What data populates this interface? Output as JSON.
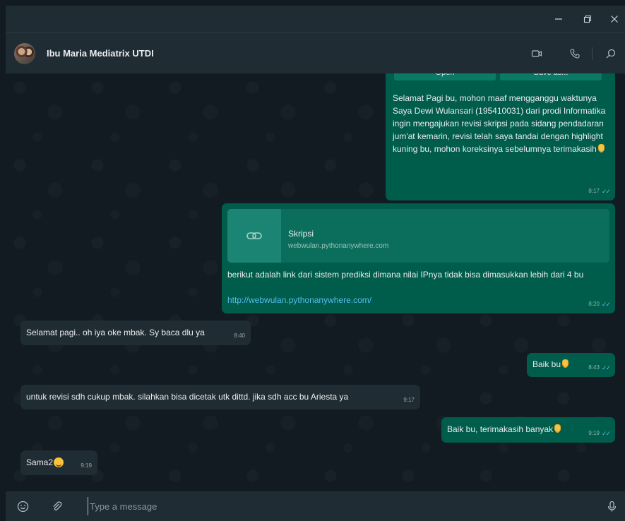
{
  "window": {
    "minimize_icon": "minimize-icon",
    "restore_icon": "restore-icon",
    "close_icon": "close-icon"
  },
  "header": {
    "contact_name": "Ibu Maria Mediatrix UTDI",
    "icons": [
      "video-call-icon",
      "voice-call-icon",
      "search-icon"
    ]
  },
  "messages": [
    {
      "direction": "out",
      "doc_buttons": [
        "Open",
        "Save as..."
      ],
      "text": "Selamat Pagi bu, mohon maaf mengganggu waktunya\nSaya Dewi Wulansari (195410031) dari prodi Informatika ingin mengajukan revisi skripsi pada sidang pendadaran jum'at kemarin, revisi telah saya tandai dengan highlight kuning bu, mohon koreksinya sebelumnya terimakasih",
      "emoji": "pray",
      "time": "8:17",
      "read": true
    },
    {
      "direction": "out",
      "link_title": "Skripsi",
      "link_domain": "webwulan.pythonanywhere.com",
      "text": "berikut adalah link dari sistem prediksi dimana nilai IPnya tidak bisa dimasukkan lebih dari 4 bu",
      "url": "http://webwulan.pythonanywhere.com/",
      "time": "8:20",
      "read": true
    },
    {
      "direction": "in",
      "text": "Selamat pagi.. oh iya oke mbak. Sy baca dlu ya",
      "time": "8:40"
    },
    {
      "direction": "out",
      "text": "Baik bu",
      "emoji": "pray",
      "time": "8:43",
      "read": true
    },
    {
      "direction": "in",
      "text": "untuk revisi sdh cukup mbak. silahkan bisa dicetak utk dittd. jika sdh acc bu Ariesta ya",
      "time": "9:17"
    },
    {
      "direction": "out",
      "text": "Baik bu, terimakasih banyak",
      "emoji": "pray",
      "time": "9:19",
      "read": true
    },
    {
      "direction": "in",
      "text": "Sama2",
      "emoji": "smile",
      "time": "9:19"
    }
  ],
  "footer": {
    "placeholder": "Type a message",
    "icons": [
      "emoji-icon",
      "attach-icon",
      "microphone-icon"
    ]
  },
  "colors": {
    "outgoing_bubble": "#005c4b",
    "incoming_bubble": "#202c33",
    "read_ticks": "#53bdeb",
    "link": "#53bdeb"
  }
}
